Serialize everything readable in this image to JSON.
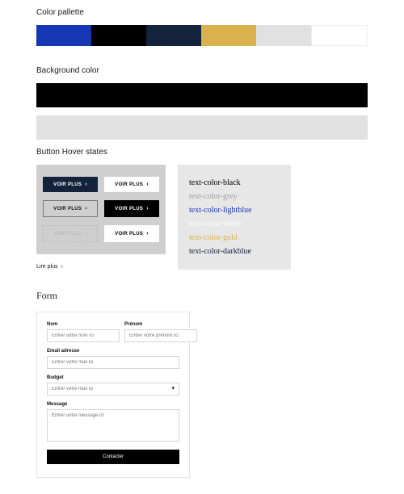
{
  "sections": {
    "palette_title": "Color pallette",
    "background_title": "Background color",
    "hover_title": "Button Hover states",
    "form_title": "Form"
  },
  "palette": [
    {
      "name": "blue",
      "hex": "#1637b3"
    },
    {
      "name": "black",
      "hex": "#000000"
    },
    {
      "name": "darkblue",
      "hex": "#13233c"
    },
    {
      "name": "gold",
      "hex": "#d9b24e"
    },
    {
      "name": "lightgrey",
      "hex": "#e1e1e1"
    },
    {
      "name": "white",
      "hex": "#ffffff"
    }
  ],
  "backgrounds": [
    {
      "name": "bg-black",
      "hex": "#000000"
    },
    {
      "name": "bg-grey",
      "hex": "#e1e1e1"
    }
  ],
  "buttons": {
    "label": "VOIR PLUS",
    "chevron": "›",
    "link_label": "Lire plus"
  },
  "text_colors": [
    {
      "label": "text-color-black",
      "color": "#000000"
    },
    {
      "label": "text-color-grey",
      "color": "#a0a0a0"
    },
    {
      "label": "text-color-lightblue",
      "color": "#1637b3"
    },
    {
      "label": "text-color-white",
      "color": "#ffffff"
    },
    {
      "label": "text-color-gold",
      "color": "#d9b24e"
    },
    {
      "label": "text-color-darkblue",
      "color": "#13233c"
    }
  ],
  "form": {
    "nom_label": "Nom",
    "prenom_label": "Prénom",
    "nom_placeholder": "Entrer votre nom ici",
    "prenom_placeholder": "Entrer votre prénom ici",
    "email_label": "Email adresse",
    "email_placeholder": "Entrer votre mail ici",
    "budget_label": "Budget",
    "budget_placeholder": "Entrer votre mail ici",
    "message_label": "Message",
    "message_placeholder": "Entrer votre message ici",
    "submit_label": "Contacter"
  }
}
